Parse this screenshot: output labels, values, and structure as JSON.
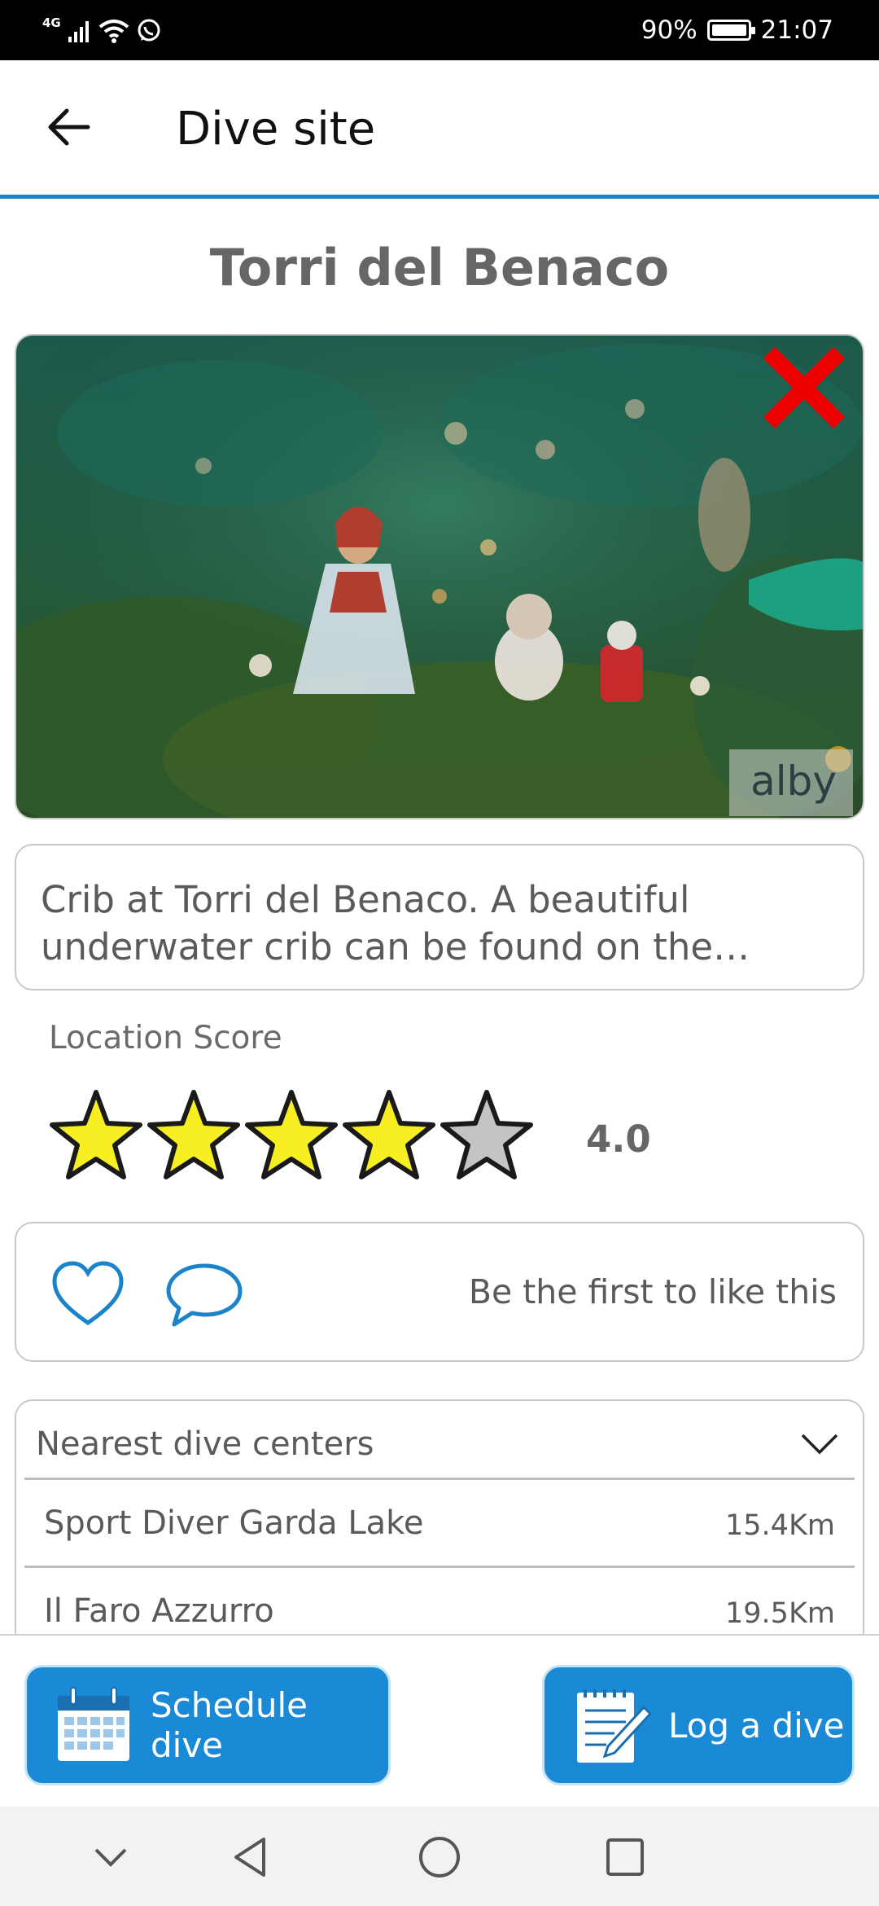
{
  "status_bar": {
    "network": "4G",
    "battery": "90%",
    "time": "21:07"
  },
  "app_bar": {
    "title": "Dive site",
    "back_icon": "arrow-left-icon"
  },
  "site": {
    "name": "Torri del Benaco",
    "photo_credit": "alby",
    "description": "Crib at Torri del Benaco. A beautiful underwater crib can be found on the north…",
    "score_label": "Location Score",
    "score": "4.0",
    "rating": 4,
    "rating_max": 5
  },
  "social": {
    "like_icon": "heart-icon",
    "comment_icon": "comment-icon",
    "like_text": "Be the first to like this"
  },
  "nearest_centers": {
    "header": "Nearest dive centers",
    "items": [
      {
        "name": "Sport Diver Garda Lake",
        "distance": "15.4Km"
      },
      {
        "name": "Il Faro Azzurro",
        "distance": "19.5Km"
      }
    ]
  },
  "actions": {
    "schedule_label": "Schedule dive",
    "log_label": "Log a dive"
  },
  "colors": {
    "accent": "#1b8ad6",
    "star_filled": "#f7ef22",
    "star_empty": "#c4c4c4",
    "remove_x": "#ef0000"
  }
}
